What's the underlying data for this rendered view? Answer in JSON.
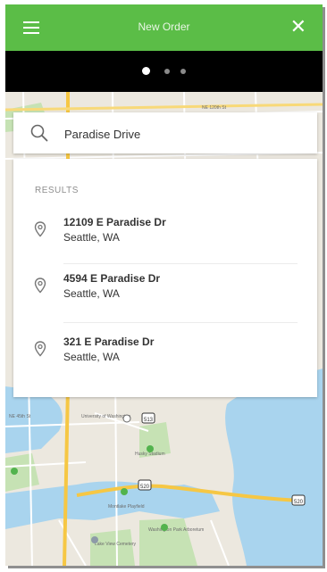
{
  "header": {
    "title": "New Order",
    "close_symbol": "✕",
    "menu_icon": "hamburger-menu-icon",
    "accent": "#5bbd47"
  },
  "pager": {
    "page_count": 3,
    "active_index": 0
  },
  "search": {
    "value": "Paradise Drive",
    "icon": "search-icon"
  },
  "results": {
    "heading": "RESULTS",
    "items": [
      {
        "street": "12109 E Paradise Dr",
        "city": "Seattle, WA"
      },
      {
        "street": "4594 E Paradise Dr",
        "city": "Seattle, WA"
      },
      {
        "street": "321 E Paradise Dr",
        "city": "Seattle, WA"
      }
    ]
  },
  "map": {
    "labels": {
      "university": "University of Washington",
      "husky_stadium": "Husky Stadium",
      "arboretum": "Washington Park Arboretum",
      "montlake": "Montlake Playfield",
      "lakeview": "Lake View Cemetery",
      "street": "NE 120th St",
      "street2": "NE 45th St"
    },
    "route_shields": [
      "513",
      "520",
      "520"
    ]
  }
}
